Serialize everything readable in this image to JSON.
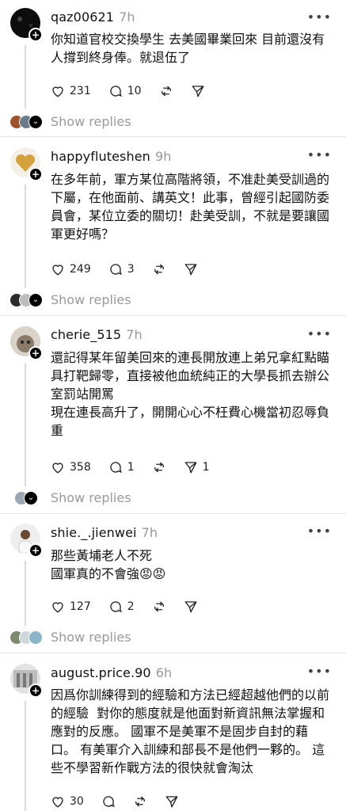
{
  "posts": [
    {
      "username": "qaz00621",
      "time": "7h",
      "text": "你知道官校交換學生 去美國畢業回來 目前還沒有\n人撐到終身俸。就退伍了",
      "likes": "231",
      "comments": "10",
      "reposts": "",
      "shares": "",
      "show_replies": "Show replies"
    },
    {
      "username": "happyfluteshen",
      "time": "9h",
      "text": "在多年前，軍方某位高階將領，不准赴美受訓過的\n下屬，在他面前、講英文！此事，曾經引起國防委\n員會，某位立委的關切！赴美受訓，不就是要讓國\n軍更好嗎？",
      "likes": "249",
      "comments": "3",
      "reposts": "",
      "shares": "",
      "show_replies": "Show replies"
    },
    {
      "username": "cherie_515",
      "time": "7h",
      "text": "還記得某年留美回來的連長開放連上弟兄拿紅點瞄\n具打靶歸零，直接被他血統純正的大學長抓去辦公\n室罰站開罵\n現在連長高升了，開開心心不枉費心機當初忍辱負\n重",
      "likes": "358",
      "comments": "1",
      "reposts": "",
      "shares": "1",
      "show_replies": "Show replies"
    },
    {
      "username": "shie._.jienwei",
      "time": "7h",
      "text": "那些黃埔老人不死\n國軍真的不會強😡😡",
      "likes": "127",
      "comments": "2",
      "reposts": "",
      "shares": "",
      "show_replies": "Show replies"
    },
    {
      "username": "august.price.90",
      "time": "6h",
      "text": "因爲你訓練得到的經驗和方法已經超越他們的以前\n的經驗  對你的態度就是他面對新資訊無法掌握和\n應對的反應。 國軍不是美軍不是固步自封的藉\n口。 有美軍介入訓練和部長不是他們一夥的。 這\n些不學習新作戰方法的很快就會淘汰",
      "likes": "30",
      "comments": "",
      "reposts": "",
      "shares": ""
    }
  ],
  "more_label": "•••"
}
